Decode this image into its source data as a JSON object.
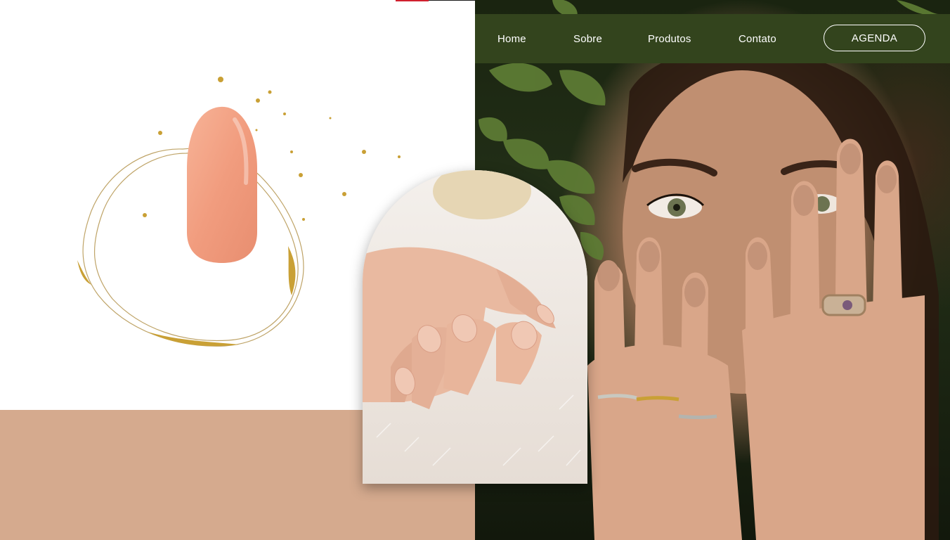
{
  "nav": {
    "links": [
      "Home",
      "Sobre",
      "Produtos",
      "Contato"
    ],
    "cta_label": "AGENDA"
  },
  "images": {
    "nail_swatch": "peach-nail-swatch-with-gold-wire",
    "arch_photo": "manicured-hand-on-white-fur",
    "hero_photo": "woman-covering-face-with-manicured-hands-among-leaves"
  },
  "colors": {
    "nav_bg": "#33441d",
    "tan_block": "#d5aa8e",
    "nail": "#f4a184",
    "gold": "#c9a035",
    "accent_red": "#d0202e"
  }
}
